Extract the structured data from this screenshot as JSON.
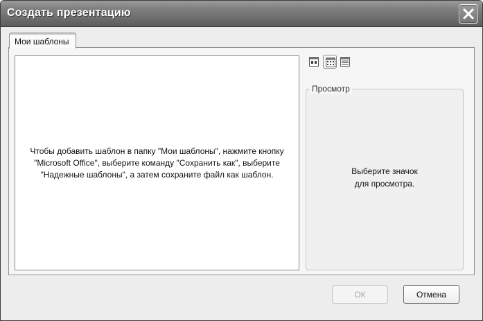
{
  "window": {
    "title": "Создать презентацию"
  },
  "tabs": [
    {
      "label": "Мои шаблоны"
    }
  ],
  "templates": {
    "empty_message": "Чтобы добавить шаблон в папку \"Мои шаблоны\", нажмите кнопку \"Microsoft Office\", выберите команду \"Сохранить как\", выберите \"Надежные шаблоны\", а затем сохраните файл как шаблон."
  },
  "view_buttons": [
    {
      "icon": "large-icons-view-icon",
      "active": false
    },
    {
      "icon": "list-view-icon",
      "active": true
    },
    {
      "icon": "details-view-icon",
      "active": false
    }
  ],
  "preview": {
    "legend": "Просмотр",
    "line1": "Выберите значок",
    "line2": "для просмотра."
  },
  "buttons": {
    "ok_label": "ОК",
    "ok_enabled": false,
    "cancel_label": "Отмена"
  },
  "icons": {
    "close": "close-icon"
  }
}
